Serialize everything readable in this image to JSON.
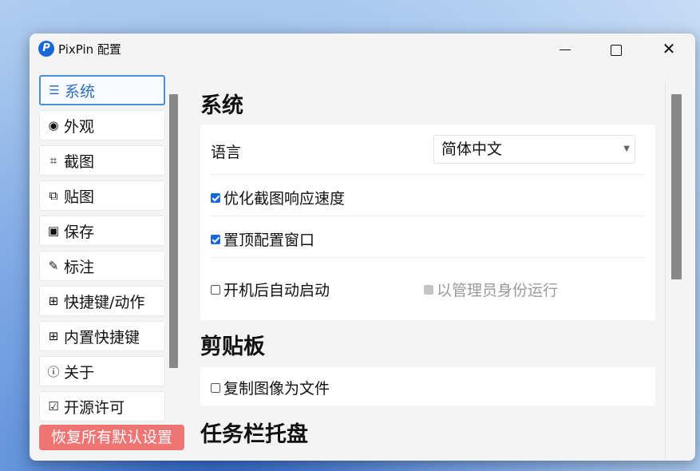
{
  "window": {
    "title": "PixPin 配置",
    "logo_letter": "P"
  },
  "controls": {
    "minimize": "minimize",
    "maximize": "maximize",
    "close": "✕"
  },
  "sidebar": {
    "items": [
      {
        "label": "系统",
        "icon": "sliders-icon",
        "glyph": "☰",
        "active": true
      },
      {
        "label": "外观",
        "icon": "palette-icon",
        "glyph": "◉",
        "active": false
      },
      {
        "label": "截图",
        "icon": "screenshot-icon",
        "glyph": "⌗",
        "active": false
      },
      {
        "label": "贴图",
        "icon": "pin-image-icon",
        "glyph": "⧉",
        "active": false
      },
      {
        "label": "保存",
        "icon": "save-icon",
        "glyph": "▣",
        "active": false
      },
      {
        "label": "标注",
        "icon": "pencil-icon",
        "glyph": "✎",
        "active": false
      },
      {
        "label": "快捷键/动作",
        "icon": "shortcut-icon",
        "glyph": "⊞",
        "active": false
      },
      {
        "label": "内置快捷键",
        "icon": "builtin-shortcut-icon",
        "glyph": "⊞",
        "active": false
      },
      {
        "label": "关于",
        "icon": "info-icon",
        "glyph": "ⓘ",
        "active": false
      },
      {
        "label": "开源许可",
        "icon": "license-icon",
        "glyph": "☑",
        "active": false
      }
    ],
    "reset_label": "恢复所有默认设置"
  },
  "main": {
    "system": {
      "title": "系统",
      "language_label": "语言",
      "language_value": "简体中文",
      "optimize_label": "优化截图响应速度",
      "optimize_checked": true,
      "ontop_label": "置顶配置窗口",
      "ontop_checked": true,
      "autostart_label": "开机后自动启动",
      "autostart_checked": false,
      "admin_label": "以管理员身份运行",
      "admin_disabled": true
    },
    "clipboard": {
      "title": "剪贴板",
      "copy_as_file_label": "复制图像为文件",
      "copy_as_file_checked": false
    },
    "tray": {
      "title": "任务栏托盘"
    }
  }
}
